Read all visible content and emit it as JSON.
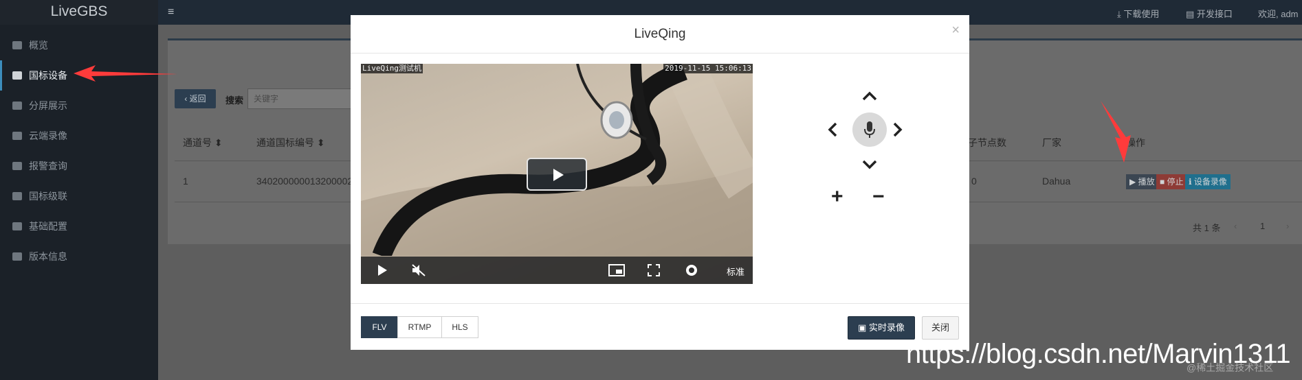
{
  "app": {
    "brand": "LiveGBS",
    "hamburger_glyph": "≡"
  },
  "sidebar": {
    "items": [
      {
        "label": "概览",
        "icon": "dashboard-icon"
      },
      {
        "label": "国标设备",
        "icon": "video-camera-icon",
        "active": true
      },
      {
        "label": "分屏展示",
        "icon": "grid-icon"
      },
      {
        "label": "云端录像",
        "icon": "cloud-icon"
      },
      {
        "label": "报警查询",
        "icon": "bell-icon"
      },
      {
        "label": "国标级联",
        "icon": "cloud-upload-icon"
      },
      {
        "label": "基础配置",
        "icon": "gears-icon"
      },
      {
        "label": "版本信息",
        "icon": "globe-icon"
      }
    ]
  },
  "topbar": {
    "download": "下载使用",
    "api": "开发接口",
    "welcome": "欢迎, adm"
  },
  "page": {
    "back": "返回",
    "search_label": "搜索",
    "search_placeholder": "关键字",
    "columns": [
      "通道号",
      "通道国标编号",
      "子节点数",
      "厂家",
      "操作"
    ],
    "row": {
      "channel": "1",
      "gb_id": "340200000013200002",
      "children": "0",
      "vendor": "Dahua"
    },
    "ops": {
      "play": "播放",
      "stop": "停止",
      "record": "设备录像"
    },
    "pager": {
      "total": "共 1 条",
      "prev": "‹",
      "page": "1",
      "next": "›"
    }
  },
  "modal": {
    "title": "LiveQing",
    "close_glyph": "×",
    "video": {
      "osd_left": "LiveQing测试机",
      "osd_right": "2019-11-15 15:06:13",
      "quality": "标准"
    },
    "ptz": {
      "zoom_in": "+",
      "zoom_out": "−"
    },
    "protocols": [
      "FLV",
      "RTMP",
      "HLS"
    ],
    "active_protocol": "FLV",
    "record_button": "实时录像",
    "close_button": "关闭"
  },
  "watermark": {
    "url": "https://blog.csdn.net/Marvin1311",
    "credit": "@稀土掘金技术社区"
  },
  "colors": {
    "sidebar_bg": "#1b2128",
    "accent": "#2c3e50",
    "annotation_arrow": "#ff3b3b"
  }
}
